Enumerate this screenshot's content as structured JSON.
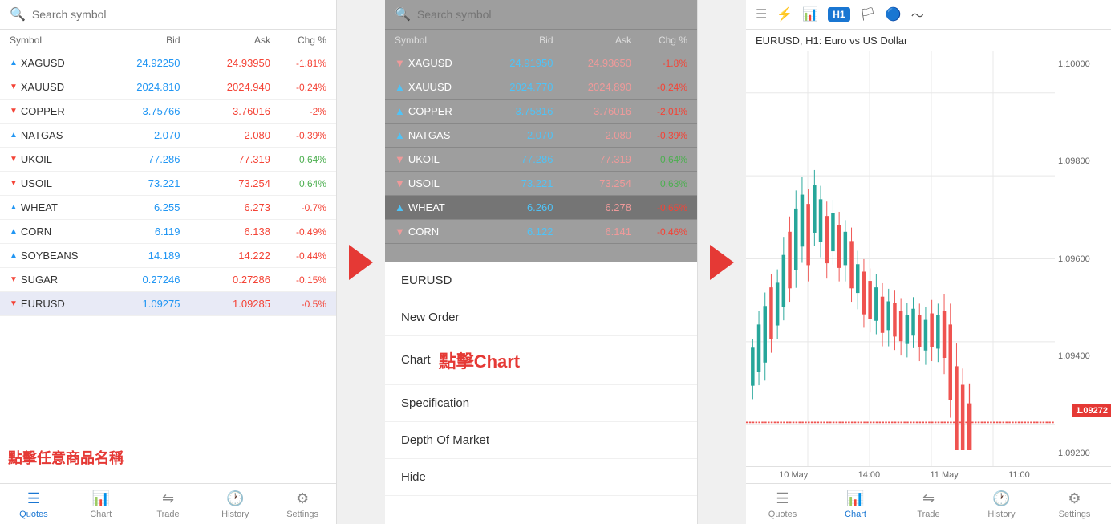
{
  "panel1": {
    "search_placeholder": "Search symbol",
    "annotation": "點擊任意商品名稱",
    "table": {
      "headers": [
        "Symbol",
        "Bid",
        "Ask",
        "Chg %"
      ],
      "rows": [
        {
          "symbol": "XAGUSD",
          "direction": "up",
          "bid": "24.92250",
          "ask": "24.93950",
          "chg": "-1.81%",
          "chg_pos": false
        },
        {
          "symbol": "XAUUSD",
          "direction": "down",
          "bid": "2024.810",
          "ask": "2024.940",
          "chg": "-0.24%",
          "chg_pos": false
        },
        {
          "symbol": "COPPER",
          "direction": "down",
          "bid": "3.75766",
          "ask": "3.76016",
          "chg": "-2%",
          "chg_pos": false
        },
        {
          "symbol": "NATGAS",
          "direction": "up",
          "bid": "2.070",
          "ask": "2.080",
          "chg": "-0.39%",
          "chg_pos": false
        },
        {
          "symbol": "UKOIL",
          "direction": "down",
          "bid": "77.286",
          "ask": "77.319",
          "chg": "0.64%",
          "chg_pos": true
        },
        {
          "symbol": "USOIL",
          "direction": "down",
          "bid": "73.221",
          "ask": "73.254",
          "chg": "0.64%",
          "chg_pos": true
        },
        {
          "symbol": "WHEAT",
          "direction": "up",
          "bid": "6.255",
          "ask": "6.273",
          "chg": "-0.7%",
          "chg_pos": false
        },
        {
          "symbol": "CORN",
          "direction": "up",
          "bid": "6.119",
          "ask": "6.138",
          "chg": "-0.49%",
          "chg_pos": false
        },
        {
          "symbol": "SOYBEANS",
          "direction": "up",
          "bid": "14.189",
          "ask": "14.222",
          "chg": "-0.44%",
          "chg_pos": false
        },
        {
          "symbol": "SUGAR",
          "direction": "down",
          "bid": "0.27246",
          "ask": "0.27286",
          "chg": "-0.15%",
          "chg_pos": false
        },
        {
          "symbol": "EURUSD",
          "direction": "down",
          "bid": "1.09275",
          "ask": "1.09285",
          "chg": "-0.5%",
          "chg_pos": false
        }
      ]
    },
    "nav": [
      {
        "label": "Quotes",
        "icon": "≡",
        "active": true
      },
      {
        "label": "Chart",
        "icon": "📈",
        "active": false
      },
      {
        "label": "Trade",
        "icon": "≔",
        "active": false
      },
      {
        "label": "History",
        "icon": "🕐",
        "active": false
      },
      {
        "label": "Settings",
        "icon": "⚙",
        "active": false
      }
    ]
  },
  "panel2": {
    "search_placeholder": "Search symbol",
    "table": {
      "headers": [
        "Symbol",
        "Bid",
        "Ask",
        "Chg %"
      ],
      "rows": [
        {
          "symbol": "XAGUSD",
          "direction": "down",
          "bid": "24.91950",
          "ask": "24.93650",
          "chg": "-1.8%",
          "chg_pos": false
        },
        {
          "symbol": "XAUUSD",
          "direction": "up",
          "bid": "2024.770",
          "ask": "2024.890",
          "chg": "-0.24%",
          "chg_pos": false
        },
        {
          "symbol": "COPPER",
          "direction": "up",
          "bid": "3.75816",
          "ask": "3.76016",
          "chg": "-2.01%",
          "chg_pos": false
        },
        {
          "symbol": "NATGAS",
          "direction": "up",
          "bid": "2.070",
          "ask": "2.080",
          "chg": "-0.39%",
          "chg_pos": false
        },
        {
          "symbol": "UKOIL",
          "direction": "down",
          "bid": "77.286",
          "ask": "77.319",
          "chg": "0.64%",
          "chg_pos": true
        },
        {
          "symbol": "USOIL",
          "direction": "down",
          "bid": "73.221",
          "ask": "73.254",
          "chg": "0.63%",
          "chg_pos": true
        },
        {
          "symbol": "WHEAT",
          "direction": "up",
          "bid": "6.260",
          "ask": "6.278",
          "chg": "-0.65%",
          "chg_pos": false
        },
        {
          "symbol": "CORN",
          "direction": "down",
          "bid": "6.122",
          "ask": "6.141",
          "chg": "-0.46%",
          "chg_pos": false
        }
      ]
    },
    "menu_items": [
      {
        "label": "EURUSD"
      },
      {
        "label": "New Order"
      },
      {
        "label": "Chart",
        "highlight": "點擊Chart"
      },
      {
        "label": "Specification"
      },
      {
        "label": "Depth Of Market"
      },
      {
        "label": "Hide"
      }
    ]
  },
  "panel3": {
    "title": "EURUSD, H1: Euro vs US Dollar",
    "timeframe": "H1",
    "price_levels": [
      "1.10000",
      "1.09800",
      "1.09600",
      "1.09400",
      "1.09200"
    ],
    "current_price": "1.09272",
    "time_labels": [
      "10 May",
      "14:00",
      "11 May",
      "11:00"
    ],
    "nav": [
      {
        "label": "Quotes",
        "icon": "≡",
        "active": false
      },
      {
        "label": "Chart",
        "icon": "📈",
        "active": true
      },
      {
        "label": "Trade",
        "icon": "≔",
        "active": false
      },
      {
        "label": "History",
        "icon": "🕐",
        "active": false
      },
      {
        "label": "Settings",
        "icon": "⚙",
        "active": false
      }
    ]
  },
  "arrows": {
    "label": "→"
  }
}
